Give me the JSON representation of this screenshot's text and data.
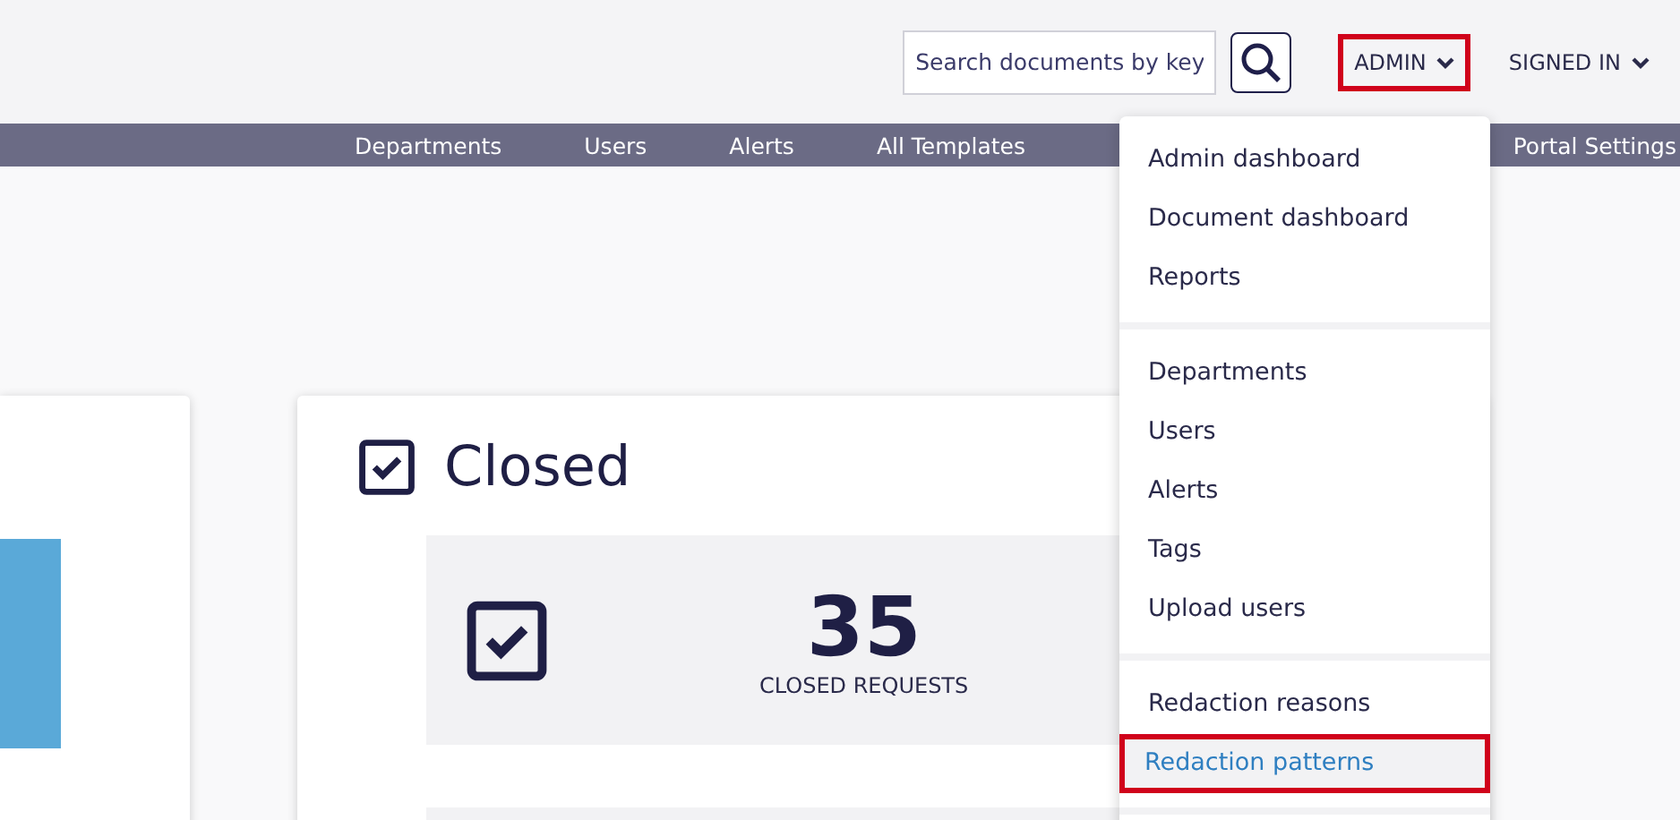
{
  "header": {
    "search": {
      "placeholder": "Search documents by key"
    },
    "admin_menu": {
      "label": "ADMIN",
      "outlined": true
    },
    "account_menu": {
      "label": "SIGNED IN"
    }
  },
  "nav": {
    "items": [
      {
        "label": "Departments"
      },
      {
        "label": "Users"
      },
      {
        "label": "Alerts"
      },
      {
        "label": "All Templates"
      },
      {
        "label": "Portal Settings"
      }
    ]
  },
  "closed_card": {
    "title": "Closed",
    "stat": {
      "value": "35",
      "label": "CLOSED REQUESTS"
    }
  },
  "dropdown": {
    "groups": [
      [
        {
          "label": "Admin dashboard",
          "selected": false
        },
        {
          "label": "Document dashboard",
          "selected": false
        },
        {
          "label": "Reports",
          "selected": false
        }
      ],
      [
        {
          "label": "Departments",
          "selected": false
        },
        {
          "label": "Users",
          "selected": false
        },
        {
          "label": "Alerts",
          "selected": false
        },
        {
          "label": "Tags",
          "selected": false
        },
        {
          "label": "Upload users",
          "selected": false
        }
      ],
      [
        {
          "label": "Redaction reasons",
          "selected": false
        },
        {
          "label": "Redaction patterns",
          "selected": true
        }
      ]
    ]
  }
}
